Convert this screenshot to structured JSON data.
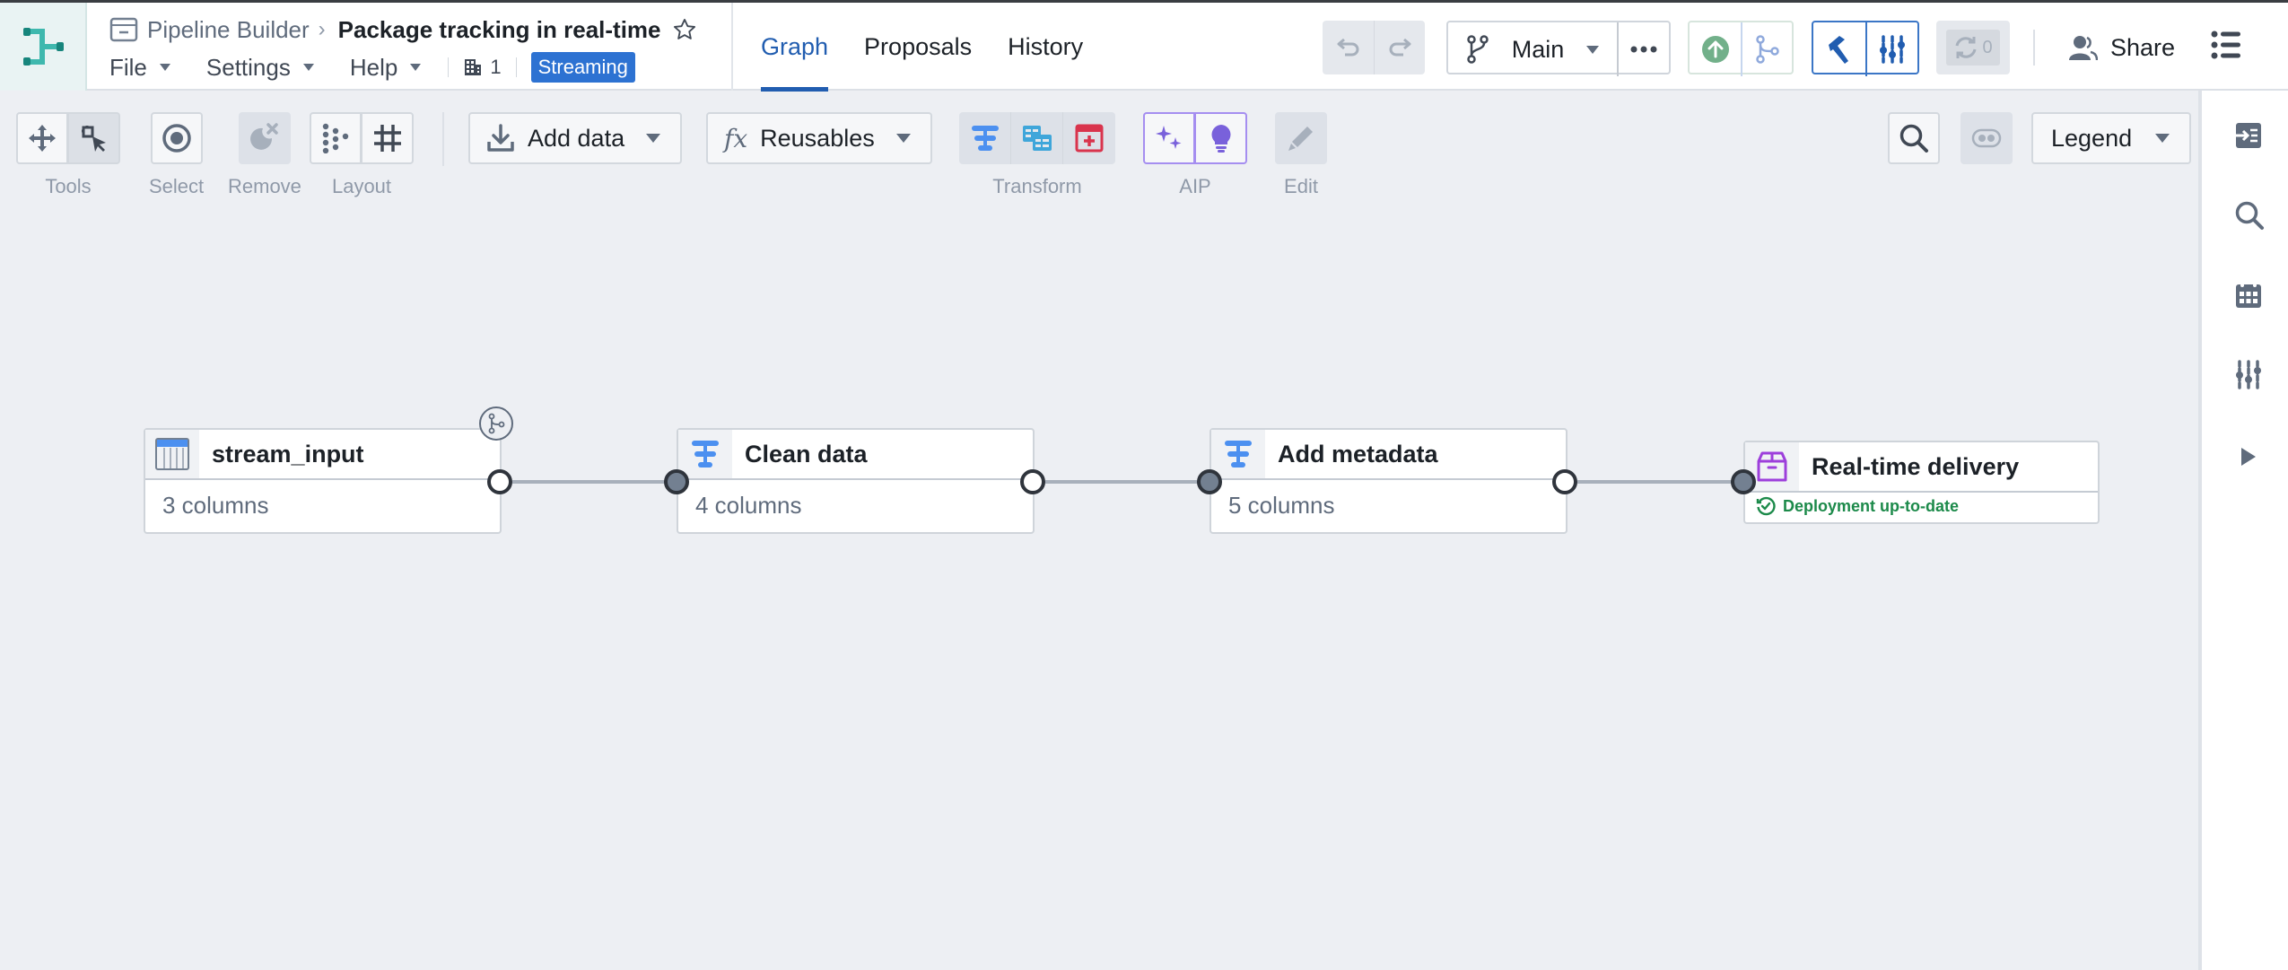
{
  "header": {
    "app_name": "Pipeline Builder",
    "pipeline_title": "Package tracking in real-time",
    "menus": [
      {
        "label": "File"
      },
      {
        "label": "Settings"
      },
      {
        "label": "Help"
      }
    ],
    "project_count": "1",
    "mode_badge": "Streaming",
    "tabs": [
      {
        "label": "Graph",
        "active": true
      },
      {
        "label": "Proposals",
        "active": false
      },
      {
        "label": "History",
        "active": false
      }
    ],
    "branch": "Main",
    "sync_count": "0",
    "share_label": "Share"
  },
  "toolbar": {
    "tools_label": "Tools",
    "select_label": "Select",
    "remove_label": "Remove",
    "layout_label": "Layout",
    "add_data_label": "Add data",
    "reusables_label": "Reusables",
    "transform_label": "Transform",
    "aip_label": "AIP",
    "edit_label": "Edit",
    "legend_label": "Legend"
  },
  "graph": {
    "nodes": [
      {
        "title": "stream_input",
        "subtitle": "3 columns",
        "type": "dataset"
      },
      {
        "title": "Clean data",
        "subtitle": "4 columns",
        "type": "transform"
      },
      {
        "title": "Add metadata",
        "subtitle": "5 columns",
        "type": "transform"
      },
      {
        "title": "Real-time delivery",
        "status": "Deployment up-to-date",
        "type": "output"
      }
    ]
  },
  "colors": {
    "accent": "#215db0",
    "streaming_badge": "#2d72d2",
    "transform_icon": "#4c90f0",
    "output_icon": "#9d3fdb",
    "aip": "#7961db",
    "status_ok": "#1c8a4a"
  }
}
